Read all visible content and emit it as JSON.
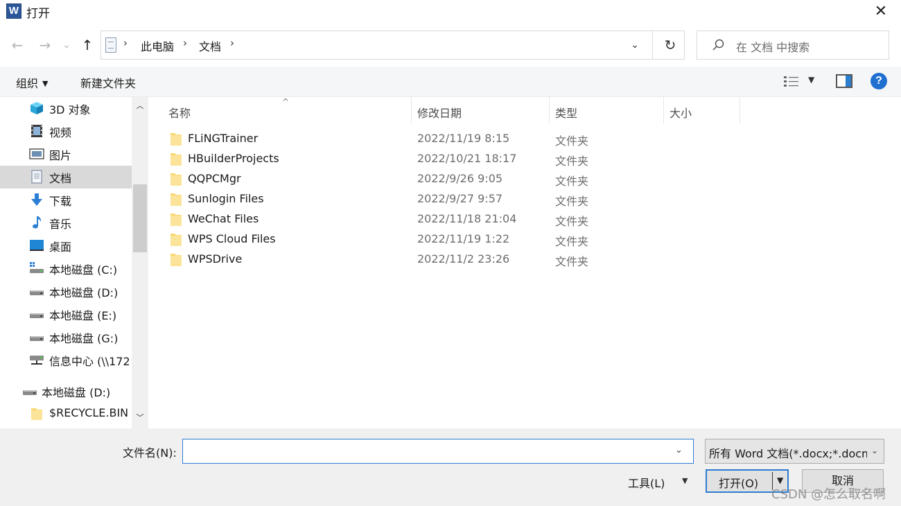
{
  "window": {
    "title": "打开",
    "app_icon_letter": "W",
    "close_symbol": "✕"
  },
  "nav": {
    "back": "←",
    "forward": "→",
    "recent": "⌄",
    "up": "↑",
    "refresh": "↻"
  },
  "address": {
    "crumbs": [
      "此电脑",
      "文档"
    ],
    "separator": "›"
  },
  "search": {
    "placeholder": "在 文档 中搜索"
  },
  "toolbar": {
    "organize": "组织",
    "new_folder": "新建文件夹",
    "help": "?"
  },
  "sidebar": {
    "items": [
      {
        "label": "3D 对象",
        "icon": "3d-objects-icon"
      },
      {
        "label": "视频",
        "icon": "video-icon"
      },
      {
        "label": "图片",
        "icon": "pictures-icon"
      },
      {
        "label": "文档",
        "icon": "documents-icon",
        "selected": true
      },
      {
        "label": "下载",
        "icon": "download-icon"
      },
      {
        "label": "音乐",
        "icon": "music-icon"
      },
      {
        "label": "桌面",
        "icon": "desktop-icon"
      },
      {
        "label": "本地磁盘 (C:)",
        "icon": "system-drive-icon"
      },
      {
        "label": "本地磁盘 (D:)",
        "icon": "drive-icon"
      },
      {
        "label": "本地磁盘 (E:)",
        "icon": "drive-icon"
      },
      {
        "label": "本地磁盘 (G:)",
        "icon": "drive-icon"
      },
      {
        "label": "信息中心 (\\\\172",
        "icon": "network-drive-icon"
      },
      {
        "label": "本地磁盘 (D:)",
        "icon": "drive-icon",
        "root": true
      },
      {
        "label": "$RECYCLE.BIN",
        "icon": "folder-icon"
      }
    ]
  },
  "columns": {
    "name": "名称",
    "modified": "修改日期",
    "type": "类型",
    "size": "大小"
  },
  "files": [
    {
      "name": "FLiNGTrainer",
      "modified": "2022/11/19 8:15",
      "type": "文件夹"
    },
    {
      "name": "HBuilderProjects",
      "modified": "2022/10/21 18:17",
      "type": "文件夹"
    },
    {
      "name": "QQPCMgr",
      "modified": "2022/9/26 9:05",
      "type": "文件夹"
    },
    {
      "name": "Sunlogin Files",
      "modified": "2022/9/27 9:57",
      "type": "文件夹"
    },
    {
      "name": "WeChat Files",
      "modified": "2022/11/18 21:04",
      "type": "文件夹"
    },
    {
      "name": "WPS Cloud Files",
      "modified": "2022/11/19 1:22",
      "type": "文件夹"
    },
    {
      "name": "WPSDrive",
      "modified": "2022/11/2 23:26",
      "type": "文件夹"
    }
  ],
  "bottom": {
    "filename_label": "文件名(N):",
    "filename_value": "",
    "filetype_value": "所有 Word 文档(*.docx;*.docm",
    "tools_label": "工具(L)",
    "open_label": "打开(O)",
    "cancel_label": "取消"
  },
  "watermark": "CSDN @怎么取名啊",
  "colors": {
    "accent": "#2f7bd1",
    "selected_bg": "#d9d9d9",
    "folder": "#f8d775",
    "help": "#1f6fd1"
  }
}
